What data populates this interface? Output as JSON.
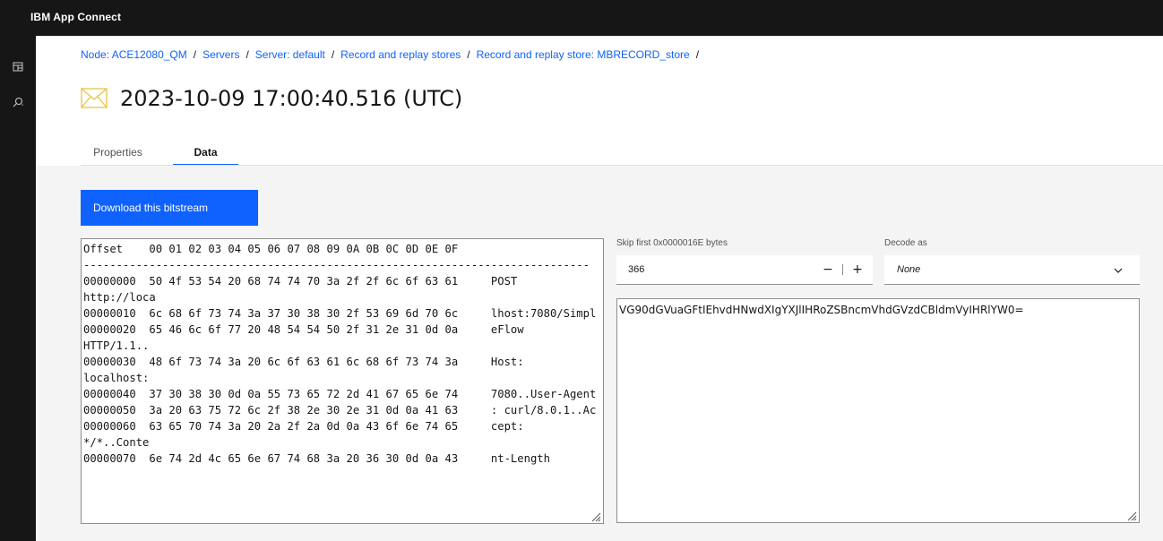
{
  "app": {
    "title": "IBM App Connect"
  },
  "sidenav": {
    "items": [
      {
        "icon": "dashboard-icon"
      },
      {
        "icon": "search-settings-icon"
      }
    ]
  },
  "breadcrumb": {
    "items": [
      "Node: ACE12080_QM",
      "Servers",
      "Server: default",
      "Record and replay stores",
      "Record and replay store: MBRECORD_store"
    ],
    "separator": "/"
  },
  "page": {
    "title": "2023-10-09 17:00:40.516 (UTC)",
    "icon": "envelope-icon"
  },
  "tabs": [
    {
      "label": "Properties",
      "active": false
    },
    {
      "label": "Data",
      "active": true
    }
  ],
  "actions": {
    "download_label": "Download this bitstream"
  },
  "hex_view": {
    "header": "Offset    00 01 02 03 04 05 06 07 08 09 0A 0B 0C 0D 0E 0F",
    "rule": "-----------------------------------------------------------------------------",
    "rows": [
      {
        "offset": "00000000",
        "hex": "50 4f 53 54 20 68 74 74 70 3a 2f 2f 6c 6f 63 61",
        "ascii": "POST http://loca"
      },
      {
        "offset": "00000010",
        "hex": "6c 68 6f 73 74 3a 37 30 38 30 2f 53 69 6d 70 6c",
        "ascii": "lhost:7080/Simpl"
      },
      {
        "offset": "00000020",
        "hex": "65 46 6c 6f 77 20 48 54 54 50 2f 31 2e 31 0d 0a",
        "ascii": "eFlow HTTP/1.1.."
      },
      {
        "offset": "00000030",
        "hex": "48 6f 73 74 3a 20 6c 6f 63 61 6c 68 6f 73 74 3a",
        "ascii": "Host: localhost:"
      },
      {
        "offset": "00000040",
        "hex": "37 30 38 30 0d 0a 55 73 65 72 2d 41 67 65 6e 74",
        "ascii": "7080..User-Agent"
      },
      {
        "offset": "00000050",
        "hex": "3a 20 63 75 72 6c 2f 38 2e 30 2e 31 0d 0a 41 63",
        "ascii": ": curl/8.0.1..Ac"
      },
      {
        "offset": "00000060",
        "hex": "63 65 70 74 3a 20 2a 2f 2a 0d 0a 43 6f 6e 74 65",
        "ascii": "cept: */*..Conte"
      },
      {
        "offset": "00000070",
        "hex": "6e 74 2d 4c 65 6e 67 74 68 3a 20 36 30 0d 0a 43",
        "ascii": "nt-Length"
      }
    ]
  },
  "skip": {
    "label": "Skip first 0x0000016E bytes",
    "value": "366",
    "decrement": "−",
    "increment": "+"
  },
  "decode": {
    "label": "Decode as",
    "selected": "None"
  },
  "decoded_output": "VG90dGVuaGFtIEhvdHNwdXIgYXJlIHRoZSBncmVhdGVzdCBldmVyIHRlYW0="
}
